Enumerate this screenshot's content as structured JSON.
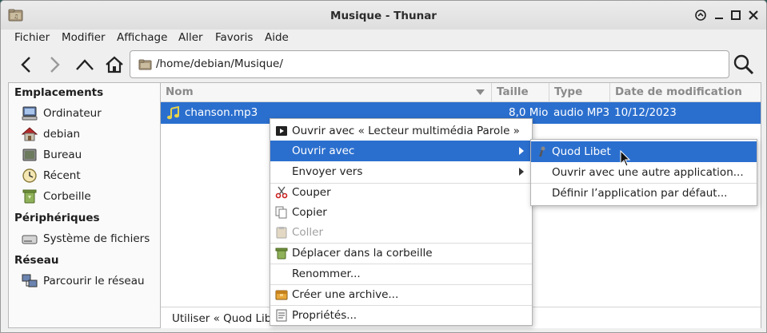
{
  "window": {
    "title": "Musique - Thunar"
  },
  "menubar": {
    "items": [
      "Fichier",
      "Modifier",
      "Affichage",
      "Aller",
      "Favoris",
      "Aide"
    ]
  },
  "location": {
    "path": "/home/debian/Musique/"
  },
  "sidebar": {
    "sections": [
      {
        "header": "Emplacements",
        "items": [
          "Ordinateur",
          "debian",
          "Bureau",
          "Récent",
          "Corbeille"
        ]
      },
      {
        "header": "Périphériques",
        "items": [
          "Système de fichiers"
        ]
      },
      {
        "header": "Réseau",
        "items": [
          "Parcourir le réseau"
        ]
      }
    ]
  },
  "columns": {
    "name": "Nom",
    "size": "Taille",
    "type": "Type",
    "date": "Date de modification"
  },
  "file": {
    "name": "chanson.mp3",
    "size": "8,0 Mio",
    "type": "audio MP3",
    "date": "10/12/2023"
  },
  "statusbar": {
    "text": "Utiliser « Quod Libet"
  },
  "context_menu": {
    "items": [
      "Ouvrir avec « Lecteur multimédia Parole »",
      "Ouvrir avec",
      "Envoyer vers",
      "Couper",
      "Copier",
      "Coller",
      "Déplacer dans la corbeille",
      "Renommer...",
      "Créer une archive...",
      "Propriétés..."
    ]
  },
  "submenu": {
    "items": [
      "Quod Libet",
      "Ouvrir avec une autre application...",
      "Définir l’application par défaut..."
    ]
  },
  "colors": {
    "selection": "#2b6fce",
    "window_bg": "#efefef"
  }
}
